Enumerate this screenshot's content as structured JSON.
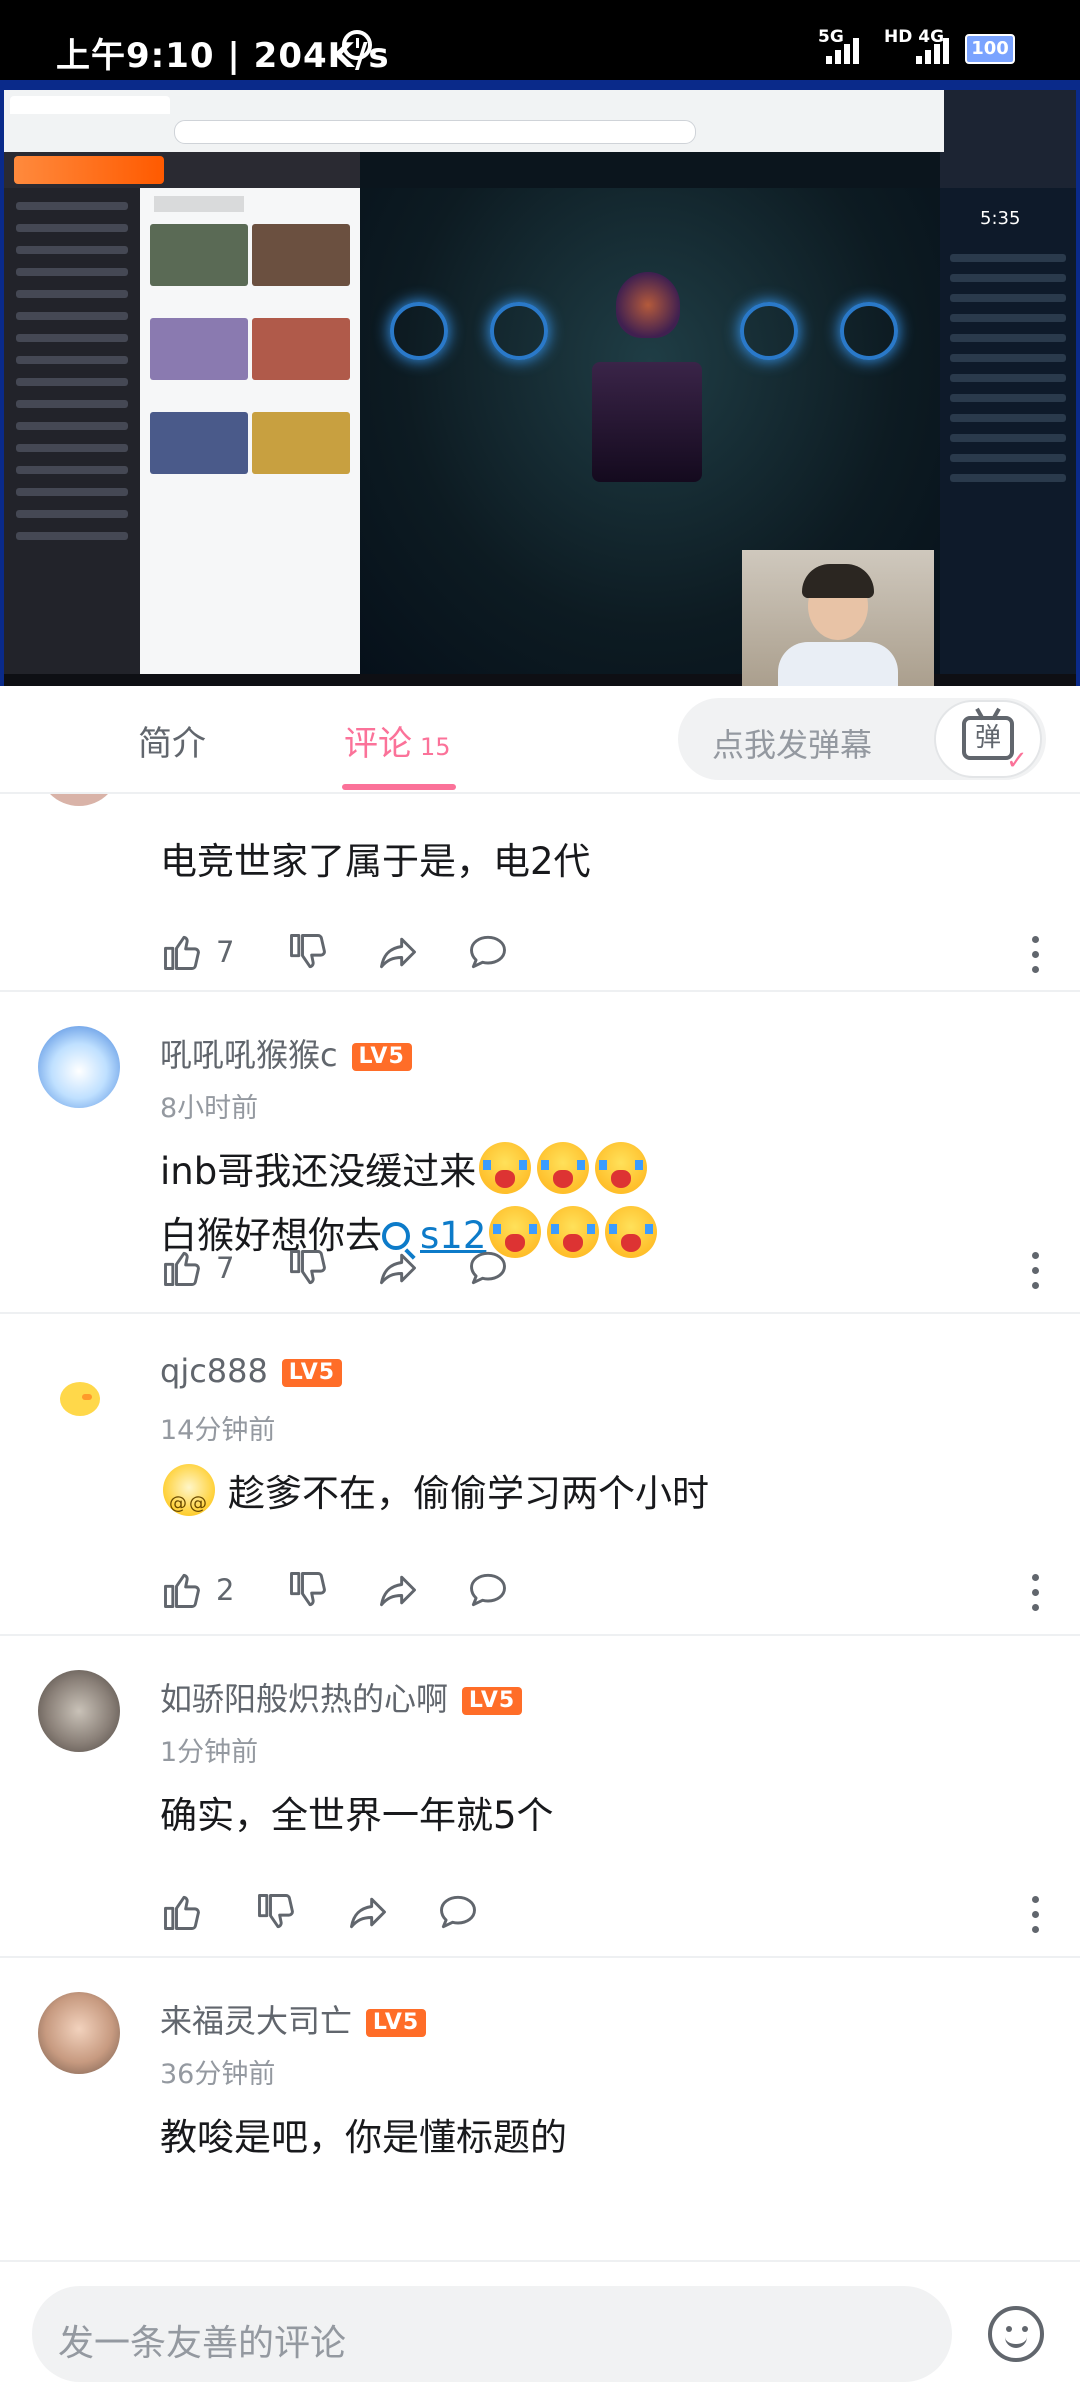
{
  "status_bar": {
    "time": "上午9:10 | 204K/s",
    "signal1": "5G",
    "signal2": "HD 4G",
    "battery": "100"
  },
  "tabs": {
    "intro": "简介",
    "comments": "评论",
    "comment_count": "15",
    "danmaku_placeholder": "点我发弹幕",
    "danmaku_button": "弹"
  },
  "video": {
    "clock": "5:35"
  },
  "comments": [
    {
      "text": "电竞世家了属于是，电2代",
      "likes": "7"
    },
    {
      "user": "吼吼吼猴猴c",
      "level": "LV5",
      "time": "8小时前",
      "line1": "inb哥我还没缓过来",
      "line2_prefix": "白猴好想你去",
      "search_term": "s12",
      "likes": "7"
    },
    {
      "user": "qjc888",
      "level": "LV5",
      "time": "14分钟前",
      "text": "趁爹不在，偷偷学习两个小时",
      "likes": "2"
    },
    {
      "user": "如骄阳般炽热的心啊",
      "level": "LV5",
      "time": "1分钟前",
      "text": "确实，全世界一年就5个"
    },
    {
      "user": "来福灵大司亡",
      "level": "LV5",
      "time": "36分钟前",
      "text": "教唆是吧，你是懂标题的"
    }
  ],
  "bottom": {
    "input_placeholder": "发一条友善的评论"
  },
  "icons": [
    "alarm-icon",
    "signal-icon",
    "battery-icon",
    "danmaku-tv-icon",
    "like-icon",
    "dislike-icon",
    "share-icon",
    "reply-icon",
    "more-icon",
    "search-icon",
    "crying-emoji",
    "dizzy-emoji",
    "emoji-button-icon"
  ],
  "colors": {
    "accent": "#fb7299",
    "level_badge": "#ff6d28",
    "link": "#0d7bc9"
  }
}
